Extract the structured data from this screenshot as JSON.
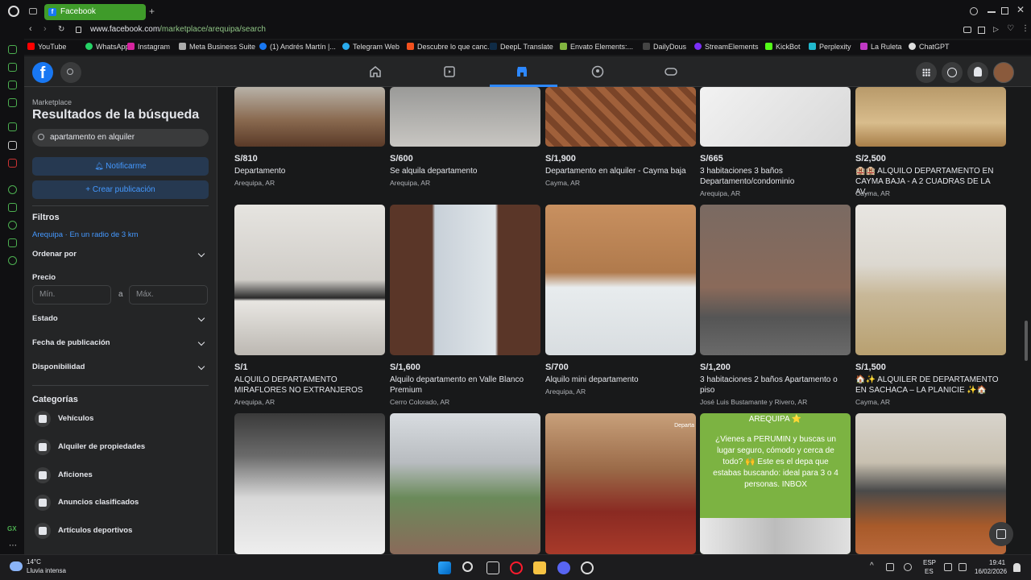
{
  "browser": {
    "tab_title": "Facebook",
    "url_host": "www.facebook.com",
    "url_path": "/marketplace/arequipa/search",
    "bookmarks": [
      "YouTube",
      "WhatsApp",
      "Instagram",
      "Meta Business Suite",
      "(1) Andrés Martín |...",
      "Telegram Web",
      "Descubre lo que canc...",
      "DeepL Translate",
      "Envato Elements:...",
      "DailyDous",
      "StreamElements",
      "KickBot",
      "Perplexity",
      "La Ruleta",
      "ChatGPT"
    ]
  },
  "colors": {
    "accent": "#2d88ff",
    "tab_green": "#3f9b2a",
    "bg": "#18191a",
    "panel": "#242526"
  },
  "sidebar": {
    "section": "Marketplace",
    "title": "Resultados de la búsqueda",
    "search_value": "apartamento en alquiler",
    "notify_label": "Notificarme",
    "create_label": "+ Crear publicación",
    "filters_heading": "Filtros",
    "location": "Arequipa · En un radio de 3 km",
    "sort_label": "Ordenar por",
    "price_label": "Precio",
    "min_placeholder": "Mín.",
    "max_placeholder": "Máx.",
    "price_sep": "a",
    "state_label": "Estado",
    "date_label": "Fecha de publicación",
    "availability_label": "Disponibilidad",
    "categories_heading": "Categorías",
    "categories": [
      "Vehículos",
      "Alquiler de propiedades",
      "Aficiones",
      "Anuncios clasificados",
      "Artículos deportivos"
    ]
  },
  "listings": [
    {
      "price": "S/810",
      "title": "Departamento",
      "location": "Arequipa, AR"
    },
    {
      "price": "S/600",
      "title": "Se alquila departamento",
      "location": "Arequipa, AR"
    },
    {
      "price": "S/1,900",
      "title": "Departamento en alquiler - Cayma baja",
      "location": "Cayma, AR"
    },
    {
      "price": "S/665",
      "title": "3 habitaciones 3 baños Departamento/condominio",
      "location": "Arequipa, AR"
    },
    {
      "price": "S/2,500",
      "title": "🏨🏨 ALQUILO DEPARTAMENTO EN CAYMA BAJA - A 2 CUADRAS DE LA AV...",
      "location": "Cayma, AR"
    },
    {
      "price": "S/1",
      "title": "ALQUILO DEPARTAMENTO MIRAFLORES NO EXTRANJEROS",
      "location": "Arequipa, AR"
    },
    {
      "price": "S/1,600",
      "title": "Alquilo departamento en Valle Blanco Premium",
      "location": "Cerro Colorado, AR"
    },
    {
      "price": "S/700",
      "title": "Alquilo mini departamento",
      "location": "Arequipa, AR"
    },
    {
      "price": "S/1,200",
      "title": "3 habitaciones 2 baños Apartamento o piso",
      "location": "José Luis Bustamante y Rivero, AR"
    },
    {
      "price": "S/1,500",
      "title": "🏠✨ ALQUILER DE DEPARTAMENTO EN SACHACA – LA PLANICIE ✨🏠",
      "location": "Cayma, AR"
    }
  ],
  "promo_card": {
    "heading": "AREQUIPA ⭐",
    "text": "¿Vienes a PERUMIN y buscas un lugar seguro, cómodo y cerca de todo? 🙌 Este es el depa que estabas buscando: ideal para 3 o 4 personas. INBOX",
    "corner": "Departa"
  },
  "taskbar": {
    "temp": "14°C",
    "weather": "Lluvia intensa",
    "lang1": "ESP",
    "lang2": "ES",
    "time": "19:41",
    "date": "16/02/2026"
  }
}
